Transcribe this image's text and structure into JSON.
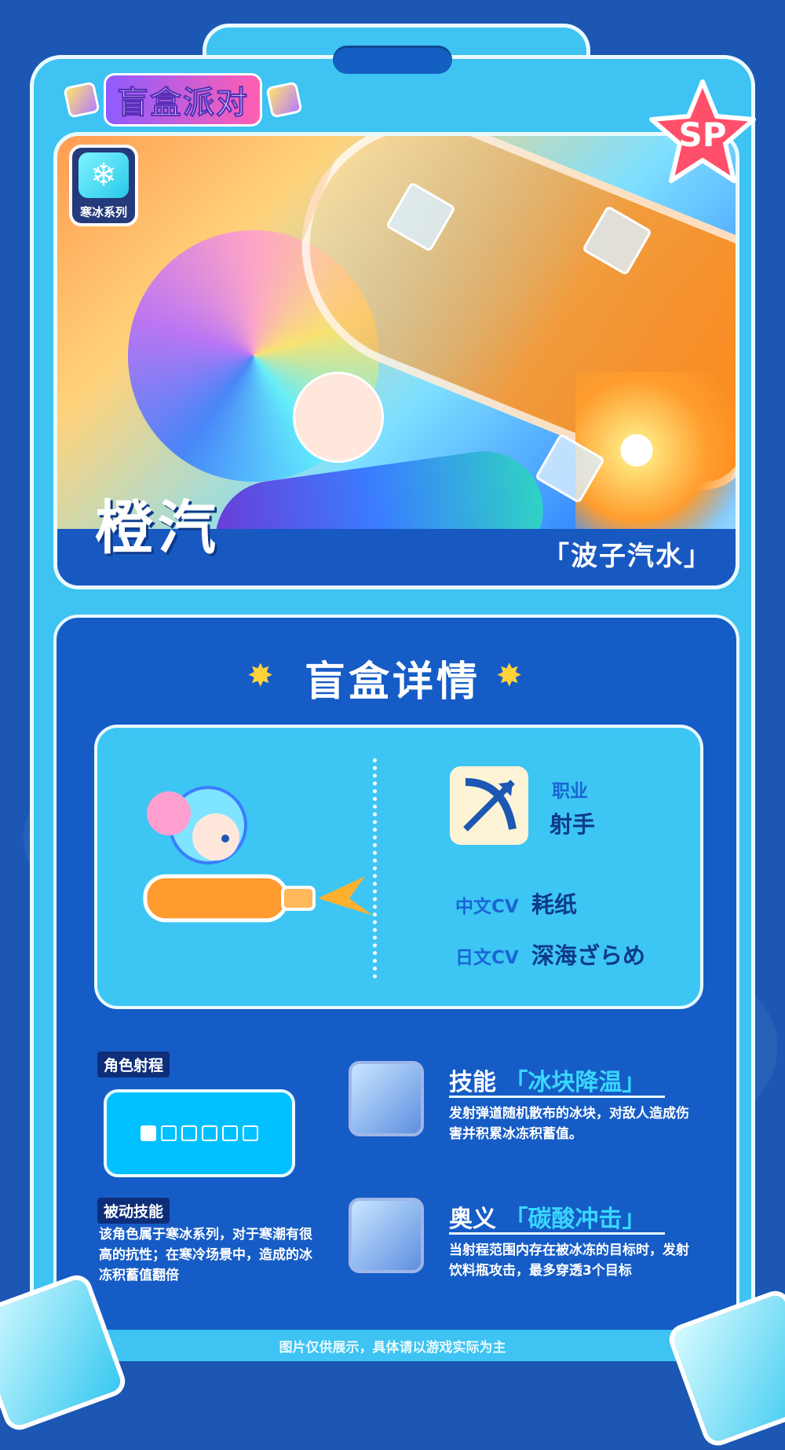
{
  "logo": {
    "text": "盲盒派对"
  },
  "card": {
    "series_label": "寒冰系列",
    "series_icon": "snowflake-icon",
    "rarity_badge": "SP",
    "character_name": "橙汽",
    "character_title": "「波子汽水」"
  },
  "details": {
    "title": "盲盒详情",
    "class_label": "职业",
    "class_value": "射手",
    "cn_cv_label": "中文CV",
    "cn_cv_value": "耗纸",
    "jp_cv_label": "日文CV",
    "jp_cv_value": "深海ざらめ",
    "range_label": "角色射程",
    "range_level": 1,
    "range_max": 6,
    "passive_label": "被动技能",
    "passive_text": "该角色属于寒冰系列，对于寒潮有很高的抗性；在寒冷场景中，造成的冰冻积蓄值翻倍",
    "skill": {
      "label": "技能",
      "name": "「冰块降温」",
      "desc": "发射弹道随机散布的冰块，对敌人造成伤害并积累冰冻积蓄值。"
    },
    "ultimate": {
      "label": "奥义",
      "name": "「碳酸冲击」",
      "desc": "当射程范围内存在被冰冻的目标时，发射饮料瓶攻击，最多穿透3个目标"
    }
  },
  "footer": {
    "note": "图片仅供展示，具体请以游戏实际为主"
  },
  "colors": {
    "primary": "#1b57b3",
    "accent": "#3ec3f2",
    "label": "#1a66d4",
    "star": "#ffd23a",
    "sp": "#ff4f6a"
  }
}
